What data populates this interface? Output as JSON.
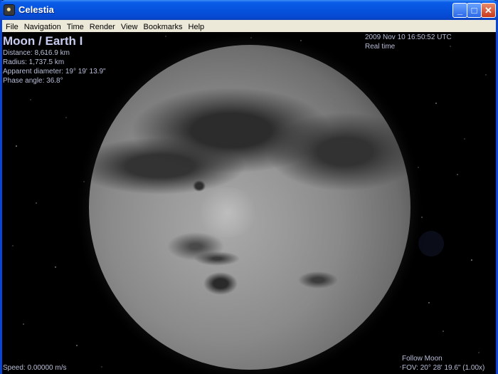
{
  "window": {
    "title": "Celestia",
    "controls": {
      "minimize": "_",
      "maximize": "□",
      "close": "✕"
    }
  },
  "menu": [
    "File",
    "Navigation",
    "Time",
    "Render",
    "View",
    "Bookmarks",
    "Help"
  ],
  "hud": {
    "object_name": "Moon / Earth I",
    "distance": "Distance: 8,616.9 km",
    "radius": "Radius: 1,737.5 km",
    "apparent_diameter": "Apparent diameter: 19° 19' 13.9\"",
    "phase_angle": "Phase angle: 36.8°",
    "datetime": "2009 Nov 10 16:50:52 UTC",
    "time_mode": "Real time",
    "follow": "Follow Moon",
    "fov": "FOV: 20° 28' 19.6\" (1.00x)",
    "speed": "Speed: 0.00000 m/s"
  },
  "colors": {
    "titlebar": "#0653de",
    "hud_text": "#b9bed8",
    "menubar": "#ece9d8"
  },
  "icons": {
    "app": "celestia-app-icon"
  }
}
